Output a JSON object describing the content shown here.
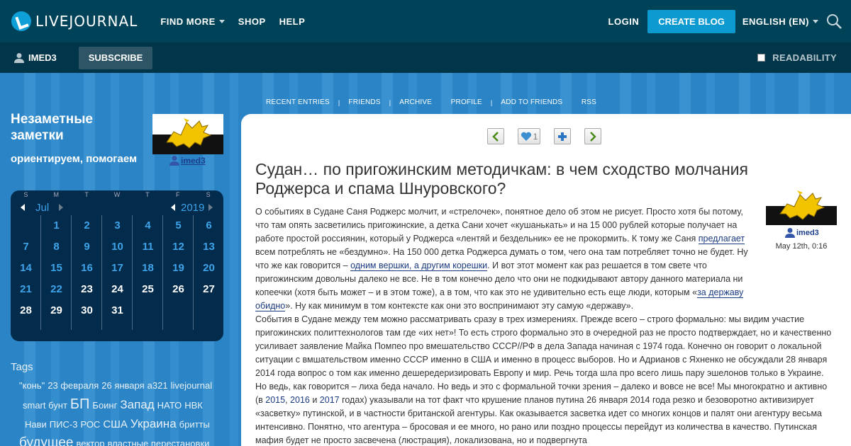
{
  "topnav": {
    "logo_text": "LIVEJOURNAL",
    "links": [
      "FIND MORE",
      "SHOP",
      "HELP"
    ],
    "login": "LOGIN",
    "create_blog": "CREATE BLOG",
    "language": "ENGLISH (EN)"
  },
  "subnav": {
    "username": "IMED3",
    "subscribe": "SUBSCRIBE",
    "readability": "READABILITY"
  },
  "sidebar": {
    "title": "Незаметные заметки",
    "subtitle": "ориентируем, помогаем",
    "username": "imed3",
    "calendar": {
      "month": "Jul",
      "year": "2019",
      "dow": [
        "S",
        "M",
        "T",
        "W",
        "T",
        "F",
        "S"
      ],
      "weeks": [
        [
          "",
          "1",
          "2",
          "3",
          "4",
          "5",
          "6"
        ],
        [
          "7",
          "8",
          "9",
          "10",
          "11",
          "12",
          "13"
        ],
        [
          "14",
          "15",
          "16",
          "17",
          "18",
          "19",
          "20"
        ],
        [
          "21",
          "22",
          "23",
          "24",
          "25",
          "26",
          "27"
        ],
        [
          "28",
          "29",
          "30",
          "31",
          "",
          "",
          ""
        ]
      ],
      "linked_color": "#3ea3e8",
      "plain_color": "#ffffff"
    },
    "tags_title": "Tags",
    "tags": [
      "\"конь\"",
      "23 февраля",
      "26 января",
      "a321",
      "livejournal",
      "smart бунт",
      "БП",
      "Боинг",
      "Запад",
      "НАТО",
      "НВК",
      "Нави",
      "ПИС-3",
      "РОС",
      "США",
      "Украина",
      "бритты",
      "будущее",
      "вектор",
      "властные перестановки"
    ]
  },
  "journal_nav": [
    "RECENT ENTRIES",
    "FRIENDS",
    "ARCHIVE",
    "PROFILE",
    "ADD TO FRIENDS",
    "RSS"
  ],
  "entry": {
    "like_count": "1",
    "title": "Судан… по пригожинским методичкам: в чем сходство молчания Роджерса и спама Шнуровского?",
    "username": "imed3",
    "date": "May 12th, 0:16",
    "p1_a": "О событиях в Судане Саня Роджерс молчит, и «стрелочек», понятное дело об этом не рисует. Просто хотя бы потому, что там опять засветились пригожинские, а детка Сани хочет «кушанькать» и на 15 000 рублей которые получает на работе простой россиянин, который у Роджерса «лентяй и бездельник» ее не прокормить. К тому же Саня ",
    "p1_link1": "предлагает",
    "p1_b": " всем потреблять не «бездумно». На 150 000 детка Роджерса думать о том, чего она там потребляет точно не будет. Ну что же как говорится – ",
    "p1_link2": "одним вершки, а другим корешки",
    "p1_c": ". И вот этот момент как раз решается в том свете что пригожинским довольны далеко не все. Не в том конечно дело что они не подкидывают автору данного материала ни копеечки (хотя быть может – и в этом тоже), а в том, что как это не удивительно есть еще люди, которым «",
    "p1_link3": "за державу обидно",
    "p1_d": "». Ну как минимум в том контексте как они это воспринимают эту самую «державу».",
    "p2_a": "События в Судане между тем можно рассматривать сразу в трех измерениях. Прежде всего – строго формально: мы видим участие пригожинских политтехнологов там где «их нет»! То есть строго формально это в очередной раз не просто подтверждает, но и качественно усиливает заявление Майка Помпео про вмешательство СССР//РФ в дела Запада начиная с 1974 года. Конечно он говорит о локальной ситуации с вмшательством именно СССР именно в США и именно в процесс выборов. Но и Адрианов с Яхненко не обсуждали 28 января 2014 года вопрос о том как именно дешередеризировать Европу и мир. Речь тогда шла про всего лишь пару эшелонов только в Украине. Но ведь, как говорится – лиха беда начало. Но ведь и это с формальной точки зрения – далеко и вовсе не все! Мы многократно и активно (в ",
    "p2_y1": "2015",
    "p2_comma": ", ",
    "p2_y2": "2016",
    "p2_and": " и ",
    "p2_y3": "2017",
    "p2_b": " годах) указывали на тот факт что крушение планов путина 26 января 2014 года резко и безоворотно активизирует «засветку» путинской, и в частности британской агентуры. Как оказывается засветка идет со многих концов и палят они агентуру весьма интенсивно. Понятно, что агентура – бросовая и ее много, но рано или поздно процессы перейдут из количества в качество. Путинская мафия будет не просто засвечена (люстрация), локализована, но и подвергнута"
  }
}
